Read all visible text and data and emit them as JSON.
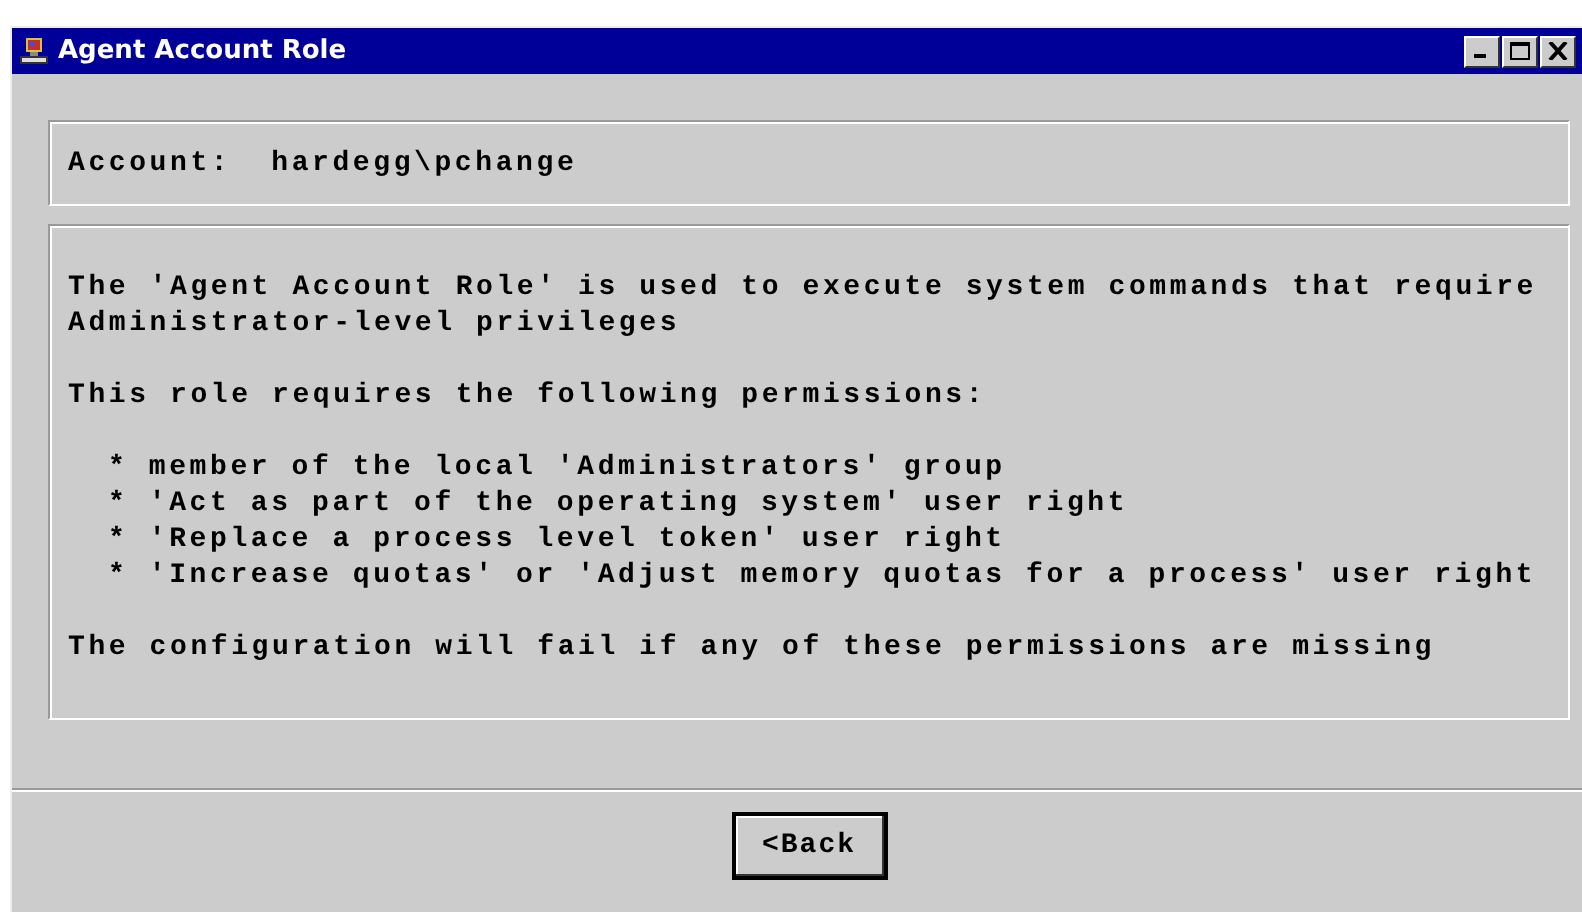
{
  "window": {
    "title": "Agent Account Role"
  },
  "account": {
    "label": "Account:",
    "value": "hardegg\\pchange"
  },
  "description": {
    "intro": [
      "The 'Agent Account Role' is used to execute system commands that require",
      "Administrator-level privileges"
    ],
    "heading": "This role requires the following permissions:",
    "bullets": [
      "* member of the local 'Administrators' group",
      "* 'Act as part of the operating system' user right",
      "* 'Replace a process level token' user right",
      "* 'Increase quotas' or 'Adjust memory quotas for a process' user right"
    ],
    "closing": "The configuration will fail if any of these permissions are missing"
  },
  "buttons": [
    {
      "label": "<Back",
      "default": true
    }
  ]
}
